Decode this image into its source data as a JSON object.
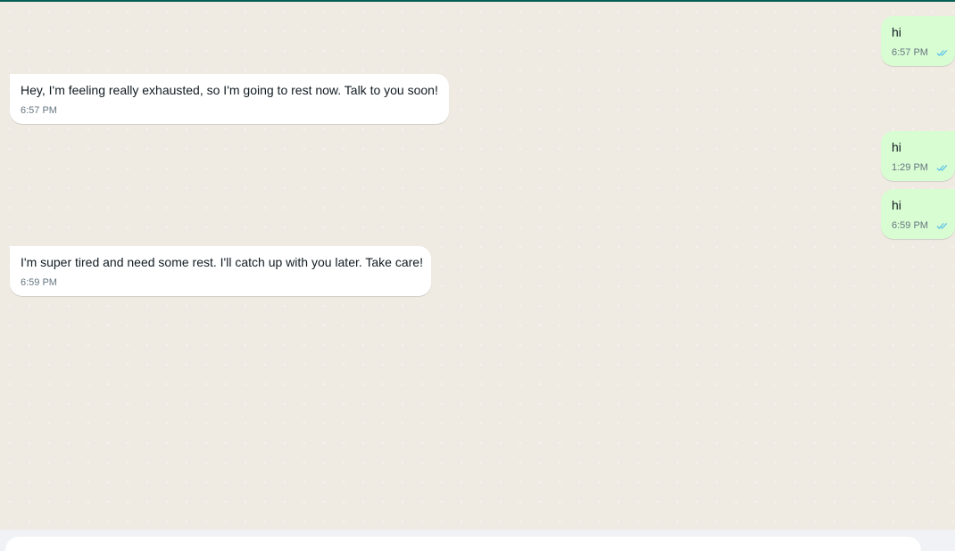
{
  "chat": {
    "messages": [
      {
        "direction": "out",
        "text": "hi",
        "time": "6:57 PM",
        "status": "read"
      },
      {
        "direction": "in",
        "text": "Hey, I'm feeling really exhausted, so I'm going to rest now. Talk to you soon!",
        "time": "6:57 PM"
      },
      {
        "direction": "out",
        "text": "hi",
        "time": "1:29 PM",
        "status": "read"
      },
      {
        "direction": "out",
        "text": "hi",
        "time": "6:59 PM",
        "status": "read"
      },
      {
        "direction": "in",
        "text": "I'm super tired and need some rest. I'll catch up with you later. Take care!",
        "time": "6:59 PM"
      }
    ]
  },
  "colors": {
    "chat_background": "#efeae2",
    "incoming_bubble": "#ffffff",
    "outgoing_bubble": "#d9fdd3",
    "read_tick": "#53bdeb",
    "timestamp": "#667781",
    "header_accent": "#075e54"
  },
  "icons": {
    "read_status": "double-check-icon"
  }
}
